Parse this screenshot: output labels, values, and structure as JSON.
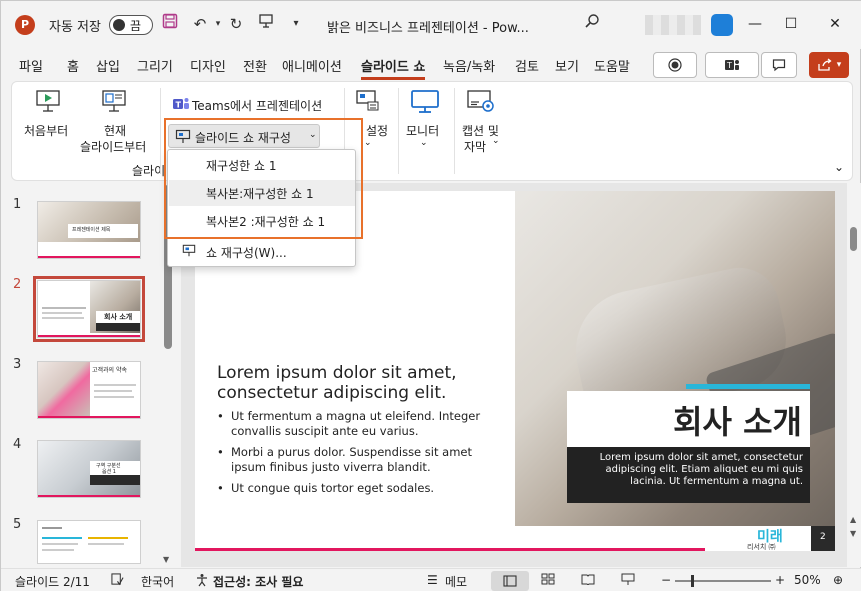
{
  "titlebar": {
    "autosave_label": "자동 저장",
    "autosave_state": "끔",
    "doc_title": "밝은 비즈니스 프레젠테이션  -  Pow..."
  },
  "menu": {
    "tabs": [
      "파일",
      "홈",
      "삽입",
      "그리기",
      "디자인",
      "전환",
      "애니메이션",
      "슬라이드 쇼",
      "녹음/녹화",
      "검토",
      "보기",
      "도움말"
    ],
    "active": "슬라이드 쇼"
  },
  "ribbon": {
    "from_beginning": "처음부터",
    "from_current_line1": "현재",
    "from_current_line2": "슬라이드부터",
    "group_label_partial": "슬라이",
    "teams_present": "Teams에서 프레젠테이션",
    "custom_show": "슬라이드 쇼 재구성",
    "setup_partial": "설정",
    "monitor": "모니터",
    "captions_line1": "캡션 및",
    "captions_line2": "자막"
  },
  "dropdown": {
    "items": [
      "재구성한 쇼 1",
      "복사본:재구성한 쇼 1",
      "복사본2 :재구성한 쇼 1"
    ],
    "footer": "쇼 재구성(W)..."
  },
  "thumbnails": {
    "numbers": [
      "1",
      "2",
      "3",
      "4",
      "5"
    ],
    "selected": "2",
    "t1_title": "프레젠테이션 제목",
    "t2_title": "회사 소개",
    "t3_title": "고객과의 약속",
    "t4_title_line1": "구역 구분선",
    "t4_title_line2": "옵션 1"
  },
  "slide": {
    "heading": "Lorem ipsum dolor sit amet, consectetur adipiscing elit.",
    "bullets": [
      "Ut fermentum a magna ut eleifend. Integer convallis suscipit ante eu varius.",
      "Morbi a purus dolor. Suspendisse sit amet ipsum finibus justo viverra blandit.",
      "Ut congue quis tortor eget sodales."
    ],
    "title_box": "회사 소개",
    "caption": "Lorem ipsum dolor sit amet, consectetur adipiscing elit. Etiam aliquet eu mi quis lacinia. Ut fermentum a magna ut.",
    "logo_main": "미래",
    "logo_sub": "리서치 ㈜",
    "page_number": "2"
  },
  "statusbar": {
    "slide_indicator": "슬라이드 2/11",
    "language": "한국어",
    "accessibility": "접근성: 조사 필요",
    "notes": "메모",
    "zoom": "50%"
  },
  "colors": {
    "accent": "#c43e1c",
    "highlight_box": "#e8712b",
    "slide_cyan": "#29b6d9",
    "slide_pink": "#e2165e",
    "selected_thumb": "#c4483b"
  }
}
